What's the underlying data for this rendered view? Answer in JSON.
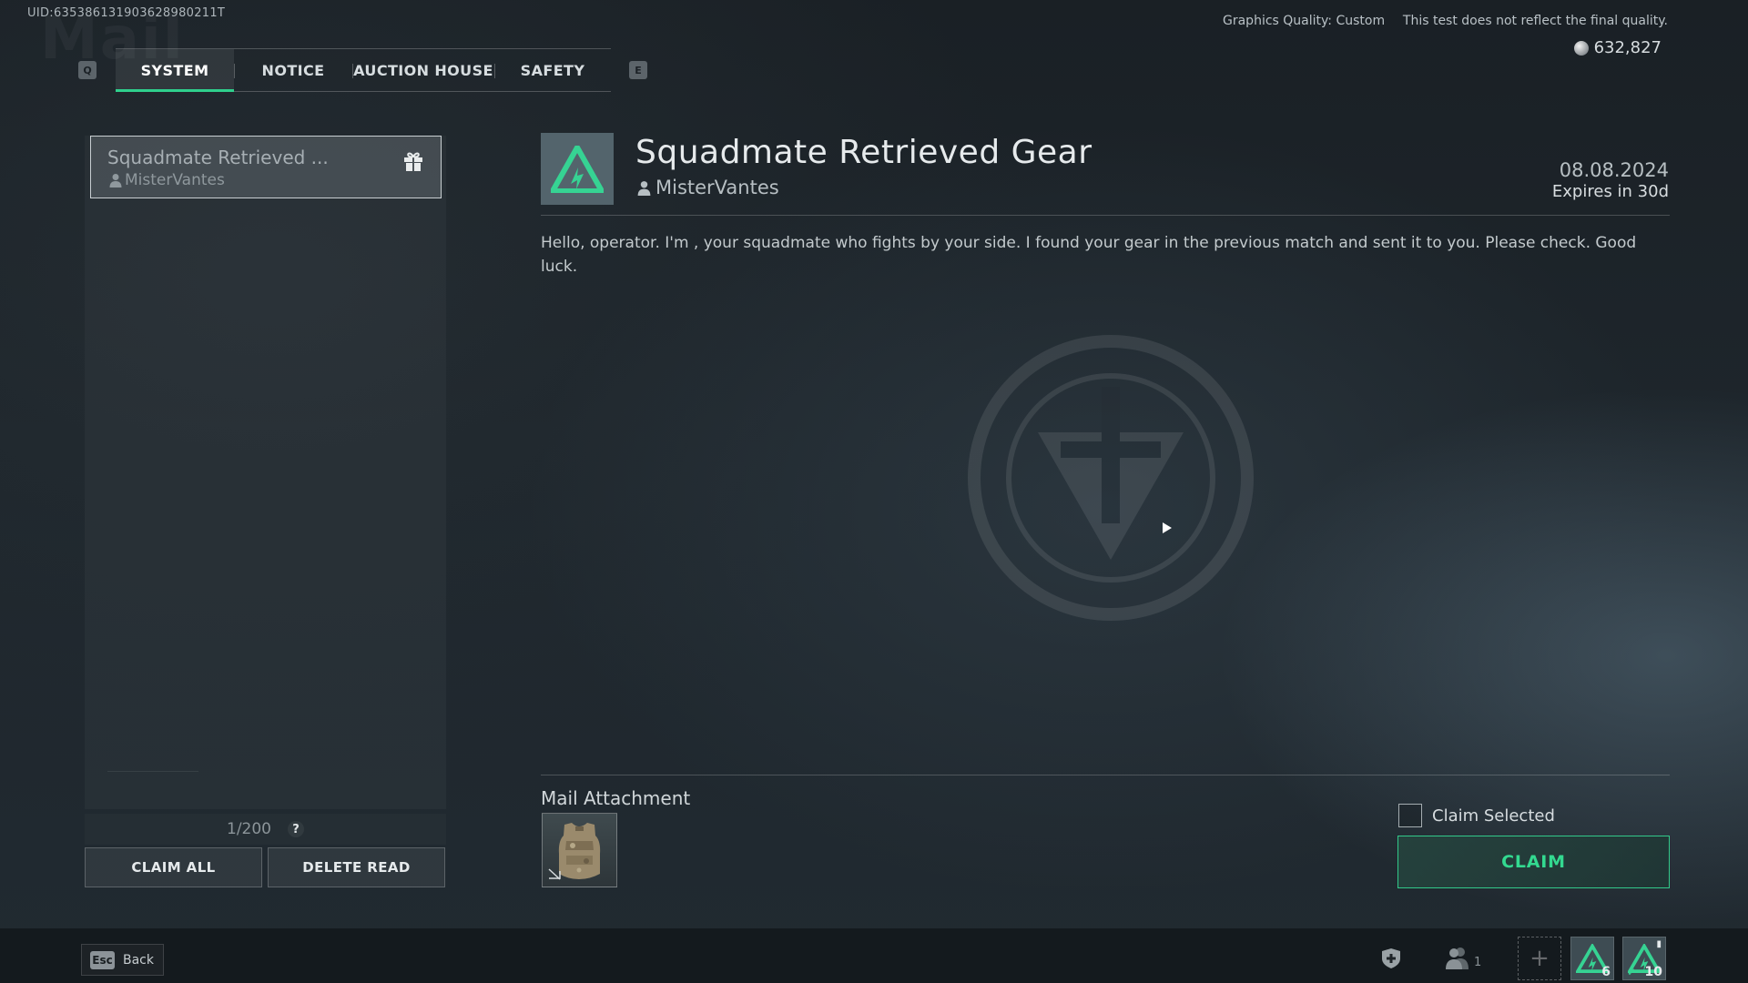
{
  "header": {
    "uid": "UID:635386131903628980211T",
    "watermark_title": "Mail",
    "graphics_quality": "Graphics Quality: Custom",
    "disclaimer": "This test does not reflect the final quality.",
    "currency_amount": "632,827"
  },
  "tabs": {
    "prev_key": "Q",
    "next_key": "E",
    "items": [
      {
        "label": "SYSTEM",
        "active": true
      },
      {
        "label": "NOTICE",
        "active": false
      },
      {
        "label": "AUCTION HOUSE",
        "active": false
      },
      {
        "label": "SAFETY",
        "active": false
      }
    ]
  },
  "mail_list": {
    "items": [
      {
        "title": "Squadmate Retrieved ...",
        "sender": "MisterVantes",
        "icon": "gift-icon"
      }
    ],
    "count": "1/200",
    "help_label": "?",
    "claim_all_label": "CLAIM ALL",
    "delete_read_label": "DELETE READ"
  },
  "mail_detail": {
    "title": "Squadmate Retrieved Gear",
    "sender": "MisterVantes",
    "date": "08.08.2024",
    "expires": "Expires in 30d",
    "body": "Hello, operator. I'm , your squadmate who fights by your side. I found your gear in the previous match and sent it to you. Please check. Good luck.",
    "attachment_label": "Mail Attachment",
    "attachment_icon": "body-armor-icon",
    "claim_selected_label": "Claim Selected",
    "claim_label": "CLAIM"
  },
  "footer": {
    "esc_key": "Esc",
    "back_label": "Back",
    "squad_count": "1",
    "add_label": "+",
    "badge_1_count": "6",
    "badge_2_count": "10"
  },
  "colors": {
    "accent_green": "#2fd08d",
    "logo_bg": "#53646c"
  }
}
